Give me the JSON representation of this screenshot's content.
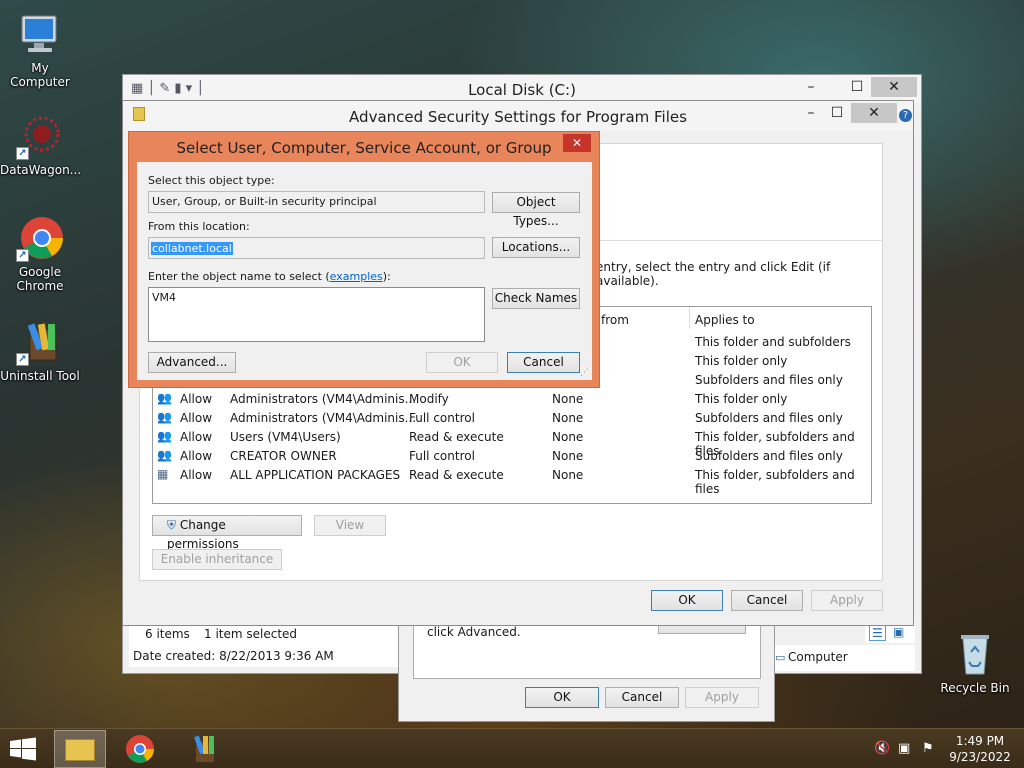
{
  "desktop": {
    "icons": [
      {
        "label": "My Computer"
      },
      {
        "label": "DataWagon..."
      },
      {
        "label": "Google Chrome"
      },
      {
        "label": "Uninstall Tool"
      },
      {
        "label": "Recycle Bin"
      }
    ]
  },
  "explorer": {
    "title": "Local Disk (C:)",
    "status_items": "6 items",
    "status_selected": "1 item selected",
    "details": "Date created: 8/22/2013 9:36 AM",
    "computer_label": "Computer"
  },
  "properties_dialog": {
    "hint": "click Advanced.",
    "ok": "OK",
    "cancel": "Cancel",
    "apply": "Apply"
  },
  "advanced_security": {
    "title": "Advanced Security Settings for Program Files",
    "instruction": "entry, select the entry and click Edit (if available).",
    "columns": {
      "inherited_from": "from",
      "applies_to": "Applies to"
    },
    "partial_applies": [
      "This folder and subfolders",
      "This folder only",
      "Subfolders and files only"
    ],
    "rows": [
      {
        "type": "Allow",
        "principal": "Administrators (VM4\\Adminis...",
        "access": "Modify",
        "inherited": "None",
        "applies": "This folder only"
      },
      {
        "type": "Allow",
        "principal": "Administrators (VM4\\Adminis...",
        "access": "Full control",
        "inherited": "None",
        "applies": "Subfolders and files only"
      },
      {
        "type": "Allow",
        "principal": "Users (VM4\\Users)",
        "access": "Read & execute",
        "inherited": "None",
        "applies": "This folder, subfolders and files"
      },
      {
        "type": "Allow",
        "principal": "CREATOR OWNER",
        "access": "Full control",
        "inherited": "None",
        "applies": "Subfolders and files only"
      },
      {
        "type": "Allow",
        "principal": "ALL APPLICATION PACKAGES",
        "access": "Read & execute",
        "inherited": "None",
        "applies": "This folder, subfolders and files"
      }
    ],
    "change_permissions": "Change permissions",
    "view": "View",
    "enable_inheritance": "Enable inheritance",
    "ok": "OK",
    "cancel": "Cancel",
    "apply": "Apply"
  },
  "select_dialog": {
    "title": "Select User, Computer, Service Account, or Group",
    "object_type_label": "Select this object type:",
    "object_type_value": "User, Group, or Built-in security principal",
    "object_types_btn": "Object Types...",
    "location_label": "From this location:",
    "location_value": "collabnet.local",
    "locations_btn": "Locations...",
    "name_label_pre": "Enter the object name to select (",
    "name_label_link": "examples",
    "name_label_post": "):",
    "name_value": "VM4",
    "check_names_btn": "Check Names",
    "advanced_btn": "Advanced...",
    "ok": "OK",
    "cancel": "Cancel"
  },
  "taskbar": {
    "time": "1:49 PM",
    "date": "9/23/2022"
  },
  "colors": {
    "dialog_accent": "#e9855a",
    "selection": "#3399ff",
    "link": "#0066cc"
  }
}
